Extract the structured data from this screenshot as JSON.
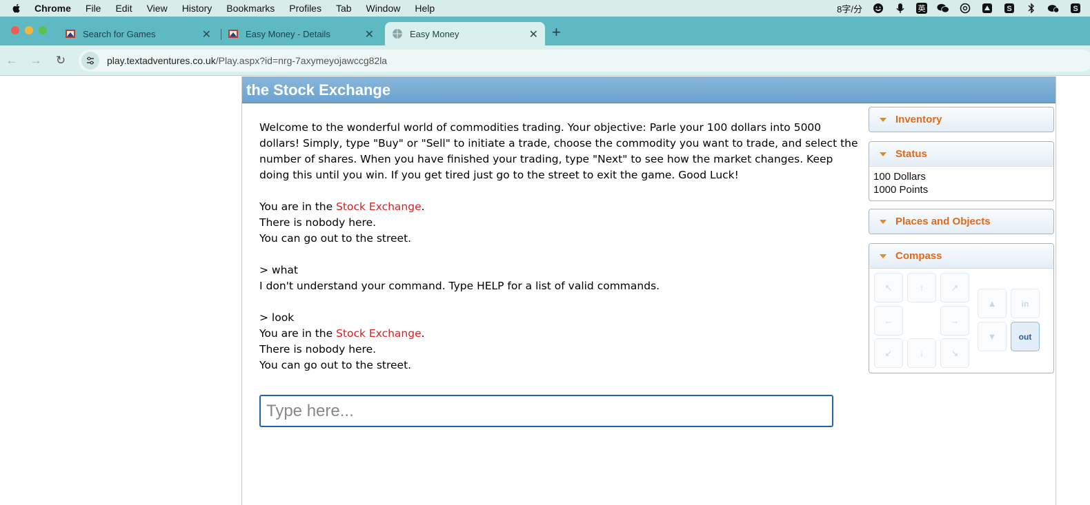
{
  "menubar": {
    "app": "Chrome",
    "items": [
      "File",
      "Edit",
      "View",
      "History",
      "Bookmarks",
      "Profiles",
      "Tab",
      "Window",
      "Help"
    ],
    "ime_status": "8字/分",
    "ime_lang": "英"
  },
  "tabs": [
    {
      "title": "Search for Games",
      "active": false
    },
    {
      "title": "Easy Money - Details",
      "active": false
    },
    {
      "title": "Easy Money",
      "active": true
    }
  ],
  "address": {
    "host": "play.textadventures.co.uk",
    "path": "/Play.aspx?id=nrg-7axymeyojawccg82la"
  },
  "game": {
    "location_title": "the Stock Exchange",
    "intro": "Welcome to the wonderful world of commodities trading. Your objective: Parle your 100 dollars into 5000 dollars! Simply, type \"Buy\" or \"Sell\" to initiate a trade, choose the commodity you want to trade, and select the number of shares. When you have finished your trading, type \"Next\" to see how the market changes. Keep doing this until you win. If you get tired just go to the street to exit the game. Good Luck!",
    "room1": {
      "prefix": "You are in the ",
      "place": "Stock Exchange",
      "suffix": ".",
      "line2": "There is nobody here.",
      "line3": "You can go out to the street."
    },
    "cmd1": "> what",
    "resp1": "I don't understand your command. Type HELP for a list of valid commands.",
    "cmd2": "> look",
    "room2": {
      "prefix": "You are in the ",
      "place": "Stock Exchange",
      "suffix": ".",
      "line2": "There is nobody here.",
      "line3": "You can go out to the street."
    },
    "input_placeholder": "Type here..."
  },
  "panes": {
    "inventory": "Inventory",
    "status": "Status",
    "status_lines": [
      "100 Dollars",
      "1000 Points"
    ],
    "places": "Places and Objects",
    "compass": "Compass",
    "compass_in": "in",
    "compass_out": "out"
  },
  "colors": {
    "tab_strip": "#5fb9c2",
    "banner": "#6aa2cf",
    "pane_header_text": "#e06a1a",
    "object_link": "#e01e1e",
    "input_border": "#2162b8"
  }
}
